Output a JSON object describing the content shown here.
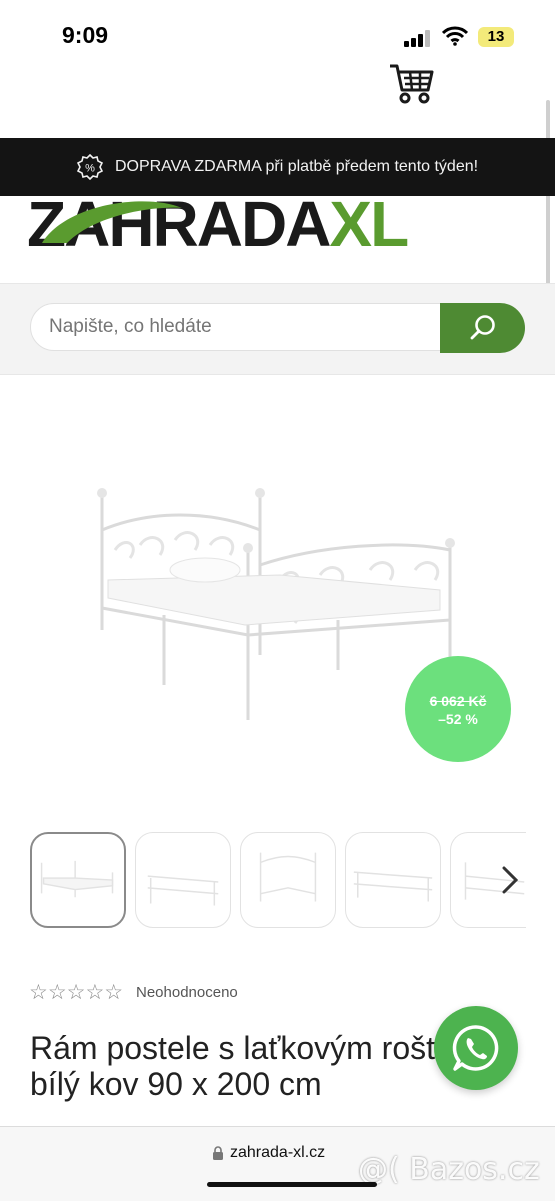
{
  "status_bar": {
    "time": "9:09",
    "battery": "13"
  },
  "promo_banner": {
    "text": "DOPRAVA ZDARMA při platbě předem tento týden!"
  },
  "logo": {
    "part1": "ZAHRADA",
    "part2": "XL"
  },
  "search": {
    "placeholder": "Napište, co hledáte"
  },
  "product": {
    "sale_old_price": "6 062 Kč",
    "sale_discount": "–52 %",
    "stars": "☆☆☆☆☆",
    "rating_text": "Neohodnoceno",
    "title": "Rám postele s laťkovým roštem bílý kov 90 x 200 cm"
  },
  "browser": {
    "url": "zahrada-xl.cz"
  },
  "watermark": "@( Bazos.cz",
  "colors": {
    "brand_green": "#4e8a33",
    "sale_green": "#6ce07d",
    "whatsapp_green": "#4db34f"
  },
  "icons": [
    "signal-icon",
    "wifi-icon",
    "cart-icon",
    "percent-icon",
    "search-icon",
    "chevron-right-icon",
    "whatsapp-icon",
    "lock-icon"
  ]
}
